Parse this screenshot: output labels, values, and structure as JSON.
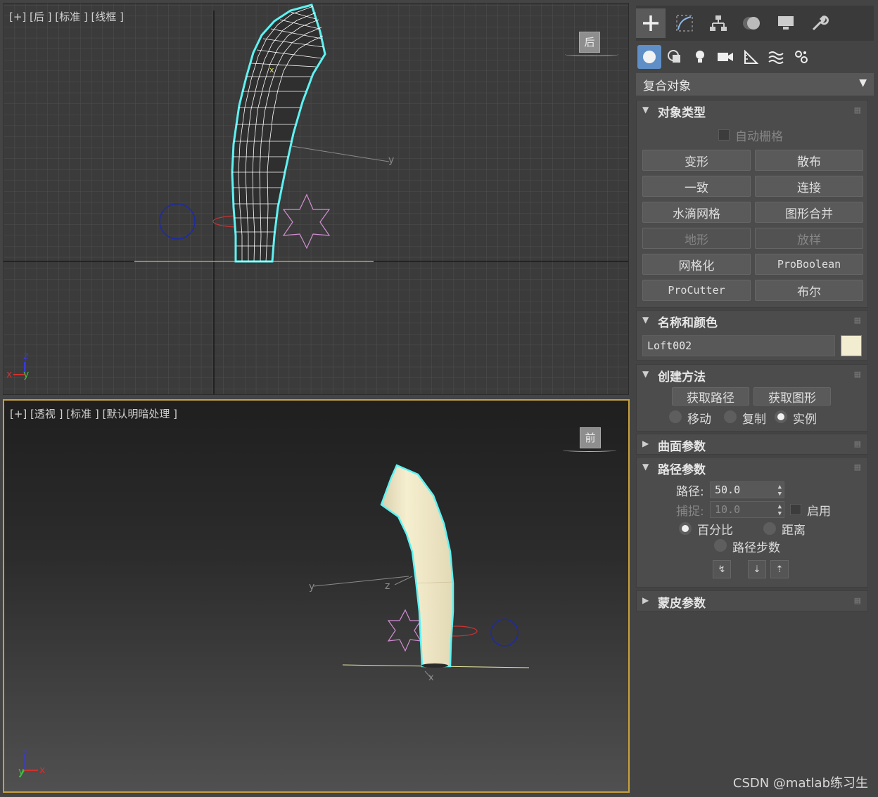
{
  "viewport_top": {
    "label": "[+] [后 ] [标准 ] [线框 ]",
    "cube_label": "后",
    "axis_labels": {
      "y": "y",
      "z": "z",
      "x": "x"
    }
  },
  "viewport_persp": {
    "label": "[+] [透视 ] [标准 ] [默认明暗处理 ]",
    "cube_label": "前",
    "axis_labels": {
      "y": "y",
      "z": "z",
      "x": "x"
    }
  },
  "panel": {
    "tabs": [
      "create-icon",
      "modify-icon",
      "hierarchy-icon",
      "motion-icon",
      "display-icon",
      "utilities-icon"
    ],
    "category_dropdown": "复合对象",
    "object_type": {
      "title": "对象类型",
      "auto_grid": "自动栅格",
      "buttons": [
        "变形",
        "散布",
        "一致",
        "连接",
        "水滴网格",
        "图形合并",
        "地形",
        "放样",
        "网格化",
        "ProBoolean",
        "ProCutter",
        "布尔"
      ]
    },
    "name_color": {
      "title": "名称和颜色",
      "name": "Loft002",
      "color": "#f2ecd0"
    },
    "creation_method": {
      "title": "创建方法",
      "get_path": "获取路径",
      "get_shape": "获取图形",
      "move": "移动",
      "copy": "复制",
      "instance": "实例"
    },
    "surface_params": {
      "title": "曲面参数"
    },
    "path_params": {
      "title": "路径参数",
      "path_label": "路径:",
      "path_value": "50.0",
      "snap_label": "捕捉:",
      "snap_value": "10.0",
      "enable": "启用",
      "percent": "百分比",
      "distance": "距离",
      "path_steps": "路径步数"
    },
    "skin_params": {
      "title": "蒙皮参数"
    }
  },
  "watermark": "CSDN @matlab练习生"
}
